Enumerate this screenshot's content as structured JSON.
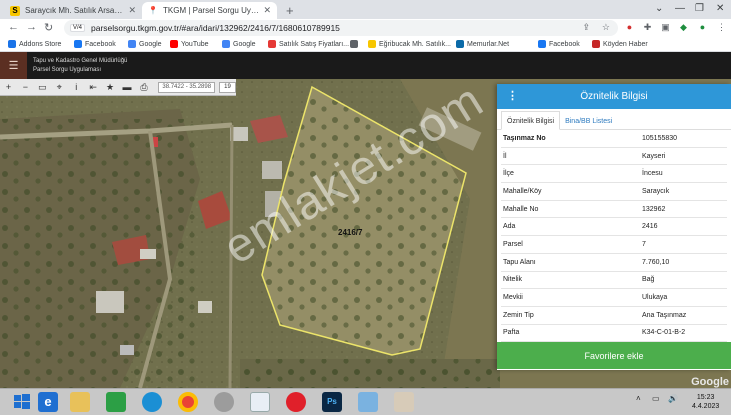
{
  "browser": {
    "tabs": [
      {
        "label": "Saraycık Mh. Satılık Arsa İlanları ve",
        "active": false
      },
      {
        "label": "TKGM | Parsel Sorgu Uygulaması",
        "active": true
      }
    ],
    "new_tab": "+",
    "url": "parselsorgu.tkgm.gov.tr/#ara/idari/132962/2416/7/1680610789915",
    "bookmarks": [
      {
        "label": "Addons Store",
        "icon": "apps-icon",
        "color": "#1a73e8"
      },
      {
        "label": "Facebook",
        "icon": "facebook-icon",
        "color": "#1877f2"
      },
      {
        "label": "Google",
        "icon": "google-icon",
        "color": "#4285f4"
      },
      {
        "label": "YouTube",
        "icon": "youtube-icon",
        "color": "#ff0000"
      },
      {
        "label": "Google",
        "icon": "google-icon",
        "color": "#4285f4"
      },
      {
        "label": "Satılık Satış Fiyatları...",
        "icon": "sahibinden-icon",
        "color": "#e53935"
      },
      {
        "label": "",
        "icon": "globe-icon",
        "color": "#5f6368"
      },
      {
        "label": "Eğribucak Mh. Satılık...",
        "icon": "sahibinden-icon",
        "color": "#f7c600"
      },
      {
        "label": "Memurlar.Net",
        "icon": "memurlar-icon",
        "color": "#0b6aa8"
      },
      {
        "label": "Facebook",
        "icon": "facebook-icon",
        "color": "#1877f2"
      },
      {
        "label": "Köyden Haber",
        "icon": "koyden-icon",
        "color": "#c62828"
      }
    ]
  },
  "app": {
    "menu_icon": "☰",
    "org_line1": "Tapu ve Kadastro Genel Müdürlüğü",
    "org_line2": "Parsel Sorgu Uygulaması"
  },
  "map": {
    "coordinates": "38.7422 - 35.2898",
    "zoom": "19",
    "parcel_label": "2416/7",
    "watermark": "emlakjet.com",
    "provider": "Google"
  },
  "panel": {
    "title": "Öznitelik Bilgisi",
    "tabs": [
      "Öznitelik Bilgisi",
      "Bina/BB Listesi"
    ],
    "rows": [
      {
        "key": "Taşınmaz No",
        "value": "105155830"
      },
      {
        "key": "İl",
        "value": "Kayseri"
      },
      {
        "key": "İlçe",
        "value": "İncesu"
      },
      {
        "key": "Mahalle/Köy",
        "value": "Saraycık"
      },
      {
        "key": "Mahalle No",
        "value": "132962"
      },
      {
        "key": "Ada",
        "value": "2416"
      },
      {
        "key": "Parsel",
        "value": "7"
      },
      {
        "key": "Tapu Alanı",
        "value": "7.760,10"
      },
      {
        "key": "Nitelik",
        "value": "Bağ"
      },
      {
        "key": "Mevkii",
        "value": "Ulukaya"
      },
      {
        "key": "Zemin Tip",
        "value": "Ana Taşınmaz"
      },
      {
        "key": "Pafta",
        "value": "K34-C-01-B-2"
      }
    ],
    "favorite_button": "Favorilere ekle"
  },
  "taskbar": {
    "time": "15:23",
    "date": "4.4.2023"
  }
}
